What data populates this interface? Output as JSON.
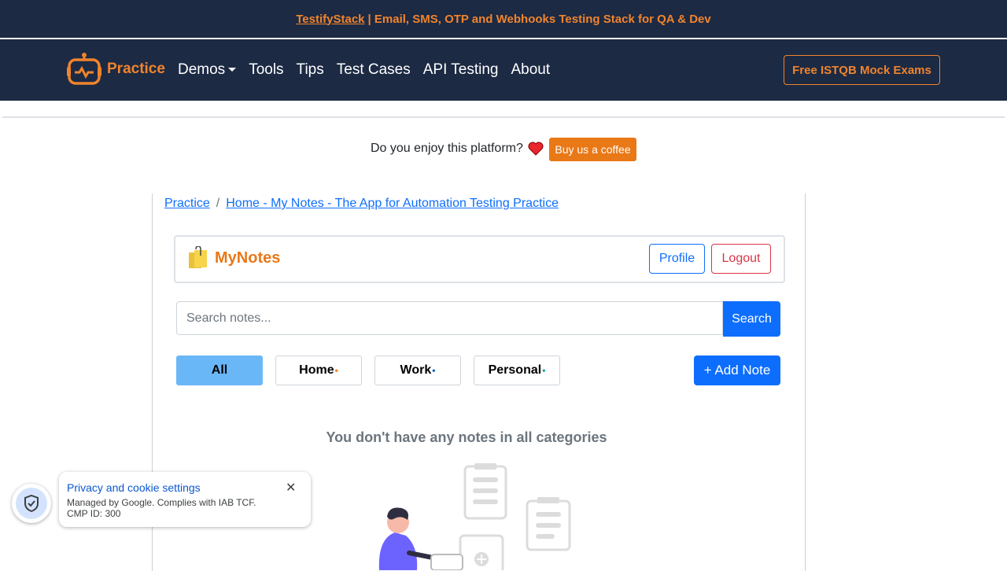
{
  "promo": {
    "link": "TestifyStack",
    "text": "| Email, SMS, OTP and Webhooks Testing Stack for QA & Dev"
  },
  "nav": {
    "brand": "Practice",
    "links": [
      "Demos",
      "Tools",
      "Tips",
      "Test Cases",
      "API Testing",
      "About"
    ],
    "cta": "Free ISTQB Mock Exams"
  },
  "support": {
    "question": "Do you enjoy this platform?",
    "button": "Buy us a coffee"
  },
  "breadcrumb": {
    "root": "Practice",
    "separator": "/",
    "current": "Home - My Notes - The App for Automation Testing Practice"
  },
  "app": {
    "title": "MyNotes",
    "profile": "Profile",
    "logout": "Logout"
  },
  "search": {
    "placeholder": "Search notes...",
    "button": "Search"
  },
  "categories": [
    {
      "label": "All",
      "active": true,
      "dot_color": ""
    },
    {
      "label": "Home",
      "active": false,
      "dot_color": "#f0842c"
    },
    {
      "label": "Work",
      "active": false,
      "dot_color": "#1a66c8"
    },
    {
      "label": "Personal",
      "active": false,
      "dot_color": "#20a4a4"
    }
  ],
  "add_note": "+ Add Note",
  "empty_message": "You don't have any notes in all categories",
  "cookie": {
    "title": "Privacy and cookie settings",
    "line1": "Managed by Google. Complies with IAB TCF.",
    "line2": "CMP ID: 300",
    "close": "✕"
  },
  "colors": {
    "navy": "#1c2a44",
    "orange": "#f0842c",
    "primary": "#0d6efd",
    "danger": "#dc3545",
    "active_filter": "#6ab7f8"
  }
}
